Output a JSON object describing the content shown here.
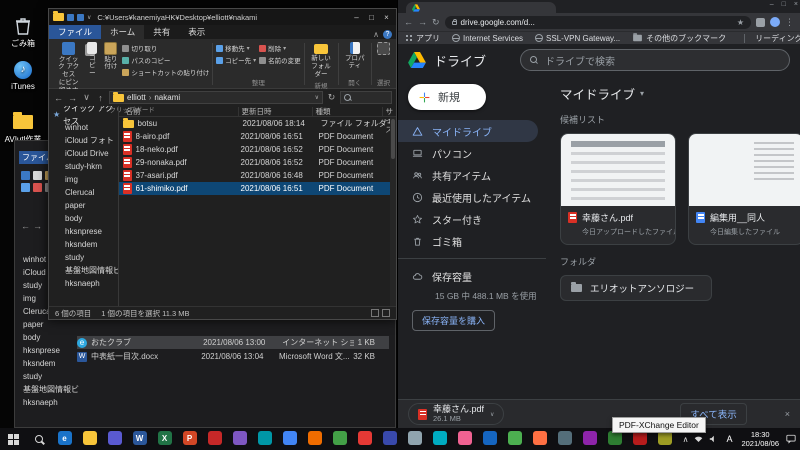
{
  "glyphs": {
    "back": "←",
    "forward": "→",
    "up": "↑",
    "down": "∨",
    "refresh": "↻",
    "crumb_sep": "›",
    "caret_down": "▾",
    "chevron_up": "∧",
    "kebab": "⋮",
    "close": "×",
    "minimize": "–",
    "maximize": "□",
    "star": "★",
    "help": "?",
    "music": "♪",
    "e": "e",
    "w": "W"
  },
  "colors": {
    "accent_blue": "#8ab4f8",
    "selection_blue": "#0e4775",
    "pdf_red": "#d93025",
    "folder_yellow": "#f8c53a",
    "drive_blue": "#2684fc",
    "drive_green": "#11a861",
    "drive_yellow": "#ffba00"
  },
  "desktop": {
    "icons": [
      {
        "label": "ごみ箱"
      },
      {
        "label": "iTunes"
      },
      {
        "label": "AVIutl作業"
      }
    ]
  },
  "explorer_back": {
    "file_tab": "ファイル",
    "tree": [
      "winhot",
      "iCloud",
      "study",
      "img",
      "Clerucal",
      "paper",
      "body",
      "hksnprese",
      "hksndem",
      "study",
      "基盤地図情報ビ",
      "hksnaeph"
    ],
    "rows": [
      {
        "name": "おたクラブ",
        "date": "2021/08/06 13:00",
        "type": "インターネット ショート...",
        "size": "1 KB"
      },
      {
        "name": "中表紙一目次.docx",
        "date": "2021/08/06 13:04",
        "type": "Microsoft Word 文...",
        "size": "32 KB"
      }
    ]
  },
  "explorer": {
    "title": "C:¥Users¥kanemiyaHK¥Desktop¥elliott¥nakami",
    "tabs": {
      "file": "ファイル",
      "home": "ホーム",
      "share": "共有",
      "view": "表示"
    },
    "ribbon": {
      "pin_line1": "クイック アクセス",
      "pin_line2": "にピン留めする",
      "copy": "コピー",
      "paste": "貼り付け",
      "cut": "切り取り",
      "copy_path": "パスのコピー",
      "paste_shortcut": "ショートカットの貼り付け",
      "move_to": "移動先",
      "copy_to": "コピー先",
      "delete": "削除",
      "rename": "名前の変更",
      "new_folder_line1": "新しい",
      "new_folder_line2": "フォルダー",
      "properties": "プロパティ",
      "groups": {
        "clipboard": "クリップボード",
        "organize": "整理",
        "new": "新規",
        "open": "開く",
        "select": "選択"
      }
    },
    "breadcrumb": {
      "root": "elliott",
      "current": "nakami"
    },
    "columns": {
      "name": "名前",
      "date": "更新日時",
      "type": "種類",
      "size": "サイズ"
    },
    "tree_header": "クイック アクセス",
    "tree": [
      "winhot",
      "iCloud フォト",
      "iCloud Drive",
      "study-hkm",
      "img",
      "Clerucal",
      "paper",
      "body",
      "hksnprese",
      "hksndem",
      "study",
      "基盤地図情報ビ",
      "hksnaeph"
    ],
    "files": [
      {
        "name": "botsu",
        "date": "2021/08/06 18:14",
        "type": "ファイル フォルダー"
      },
      {
        "name": "8-airo.pdf",
        "date": "2021/08/06 16:51",
        "type": "PDF Document"
      },
      {
        "name": "18-neko.pdf",
        "date": "2021/08/06 16:52",
        "type": "PDF Document"
      },
      {
        "name": "29-nonaka.pdf",
        "date": "2021/08/06 16:52",
        "type": "PDF Document"
      },
      {
        "name": "37-asari.pdf",
        "date": "2021/08/06 16:48",
        "type": "PDF Document"
      },
      {
        "name": "61-shimiko.pdf",
        "date": "2021/08/06 16:51",
        "type": "PDF Document"
      }
    ],
    "status_items": "6 個の項目",
    "status_selected": "1 個の項目を選択 11.3 MB"
  },
  "chrome": {
    "url": "drive.google.com/d...",
    "bookmarks": {
      "apps": "アプリ",
      "item1": "Internet Services",
      "item2": "SSL-VPN Gateway...",
      "other": "その他のブックマーク",
      "reading_list": "リーディング リスト"
    },
    "drive": {
      "logo_label": "ドライブ",
      "search_placeholder": "ドライブで検索",
      "new_button": "新規",
      "nav": [
        "マイドライブ",
        "パソコン",
        "共有アイテム",
        "最近使用したアイテム",
        "スター付き",
        "ゴミ箱"
      ],
      "storage_label": "保存容量",
      "storage_usage": "15 GB 中 488.1 MB を使用",
      "buy_button": "保存容量を購入",
      "page_title": "マイドライブ",
      "suggestions_label": "候補リスト",
      "cards": [
        {
          "name": "幸藤さん.pdf",
          "subtitle": "今日アップロードしたファイル"
        },
        {
          "name": "編集用__同人",
          "subtitle": "今日編集したファイル"
        }
      ],
      "folders_label": "フォルダ",
      "folder_name": "エリオットアンソロジー",
      "download": {
        "name": "幸藤さん.pdf",
        "size": "26.1 MB",
        "show_all": "すべて表示"
      }
    }
  },
  "tooltip": "PDF-XChange Editor",
  "taskbar": {
    "ime": "A",
    "time": "18:30",
    "date": "2021/08/06",
    "apps": [
      {
        "name": "edge",
        "color": "#1a73c9",
        "glyph": "e"
      },
      {
        "name": "explorer",
        "color": "#f8c53a",
        "glyph": ""
      },
      {
        "name": "app-indigo",
        "color": "#5a5ad1",
        "glyph": ""
      },
      {
        "name": "word",
        "color": "#2b579a",
        "glyph": "W"
      },
      {
        "name": "excel",
        "color": "#217346",
        "glyph": "X"
      },
      {
        "name": "powerpoint",
        "color": "#d24726",
        "glyph": "P"
      },
      {
        "name": "app-red",
        "color": "#c62828",
        "glyph": ""
      },
      {
        "name": "app-purple",
        "color": "#7e57c2",
        "glyph": ""
      },
      {
        "name": "app-teal",
        "color": "#0097a7",
        "glyph": ""
      },
      {
        "name": "chrome",
        "color": "#4285f4",
        "glyph": ""
      },
      {
        "name": "app-orange",
        "color": "#ef6c00",
        "glyph": ""
      },
      {
        "name": "app-green",
        "color": "#43a047",
        "glyph": ""
      },
      {
        "name": "app-scarlet",
        "color": "#e53935",
        "glyph": ""
      },
      {
        "name": "app-navy",
        "color": "#3949ab",
        "glyph": ""
      },
      {
        "name": "app-gray",
        "color": "#90a4ae",
        "glyph": ""
      },
      {
        "name": "app-cyan",
        "color": "#00acc1",
        "glyph": ""
      },
      {
        "name": "app-pink",
        "color": "#f06292",
        "glyph": ""
      },
      {
        "name": "app-blue",
        "color": "#1565c0",
        "glyph": ""
      },
      {
        "name": "pdf-xchange",
        "color": "#4caf50",
        "glyph": ""
      },
      {
        "name": "app-amber",
        "color": "#ff7043",
        "glyph": ""
      },
      {
        "name": "app-slate",
        "color": "#546e7a",
        "glyph": ""
      },
      {
        "name": "app-violet",
        "color": "#8e24aa",
        "glyph": ""
      },
      {
        "name": "app-forest",
        "color": "#2e7d32",
        "glyph": ""
      },
      {
        "name": "app-maroon",
        "color": "#b71c1c",
        "glyph": ""
      },
      {
        "name": "app-olive",
        "color": "#9e9d24",
        "glyph": ""
      }
    ]
  }
}
